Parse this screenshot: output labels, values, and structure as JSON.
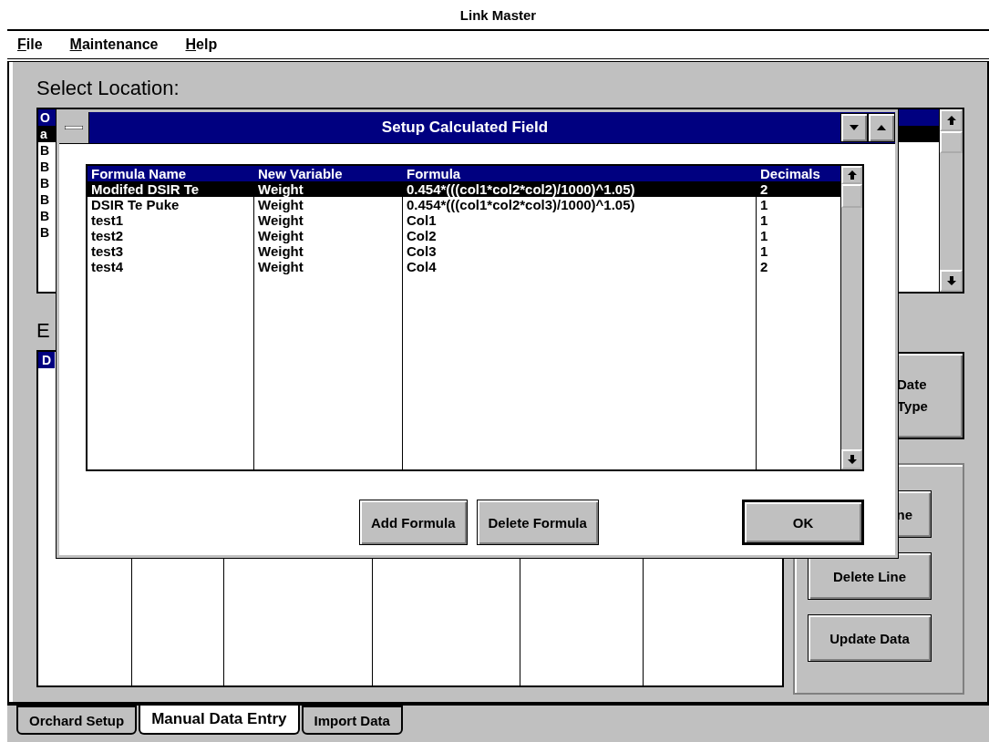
{
  "window": {
    "title": "Link Master"
  },
  "menu": [
    {
      "label": "File"
    },
    {
      "label": "Maintenance"
    },
    {
      "label": "Help"
    }
  ],
  "location": {
    "label": "Select Location:",
    "items": [
      {
        "text": "O",
        "color": "#000080"
      },
      {
        "text": "a",
        "color": "#000000"
      },
      {
        "text": "B"
      },
      {
        "text": "B"
      },
      {
        "text": "B"
      },
      {
        "text": "B"
      },
      {
        "text": "B"
      },
      {
        "text": "B"
      }
    ]
  },
  "entry": {
    "label": "E",
    "header": "D"
  },
  "side_button": {
    "label": "Date\nType"
  },
  "group_buttons": [
    {
      "label": "ne"
    },
    {
      "label": "Delete Line"
    },
    {
      "label": "Update Data"
    }
  ],
  "dialog": {
    "title": "Setup Calculated Field",
    "columns": [
      "Formula Name",
      "New Variable",
      "Formula",
      "Decimals"
    ],
    "rows": [
      {
        "cells": [
          "Modifed DSIR Te",
          "Weight",
          "0.454*(((col1*col2*col2)/1000)^1.05)",
          "2"
        ],
        "selected": true
      },
      {
        "cells": [
          "DSIR Te Puke",
          "Weight",
          "0.454*(((col1*col2*col3)/1000)^1.05)",
          "1"
        ],
        "selected": false
      },
      {
        "cells": [
          "test1",
          "Weight",
          "Col1",
          "1"
        ],
        "selected": false
      },
      {
        "cells": [
          "test2",
          "Weight",
          "Col2",
          "1"
        ],
        "selected": false
      },
      {
        "cells": [
          "test3",
          "Weight",
          "Col3",
          "1"
        ],
        "selected": false
      },
      {
        "cells": [
          "test4",
          "Weight",
          "Col4",
          "2"
        ],
        "selected": false
      }
    ],
    "buttons": [
      {
        "label": "Add Formula",
        "default": false
      },
      {
        "label": "Delete Formula",
        "default": false
      },
      {
        "label": "OK",
        "default": true
      }
    ]
  },
  "tabs": [
    {
      "label": "Orchard Setup",
      "selected": false
    },
    {
      "label": "Manual Data Entry",
      "selected": true
    },
    {
      "label": "Import Data",
      "selected": false
    }
  ]
}
